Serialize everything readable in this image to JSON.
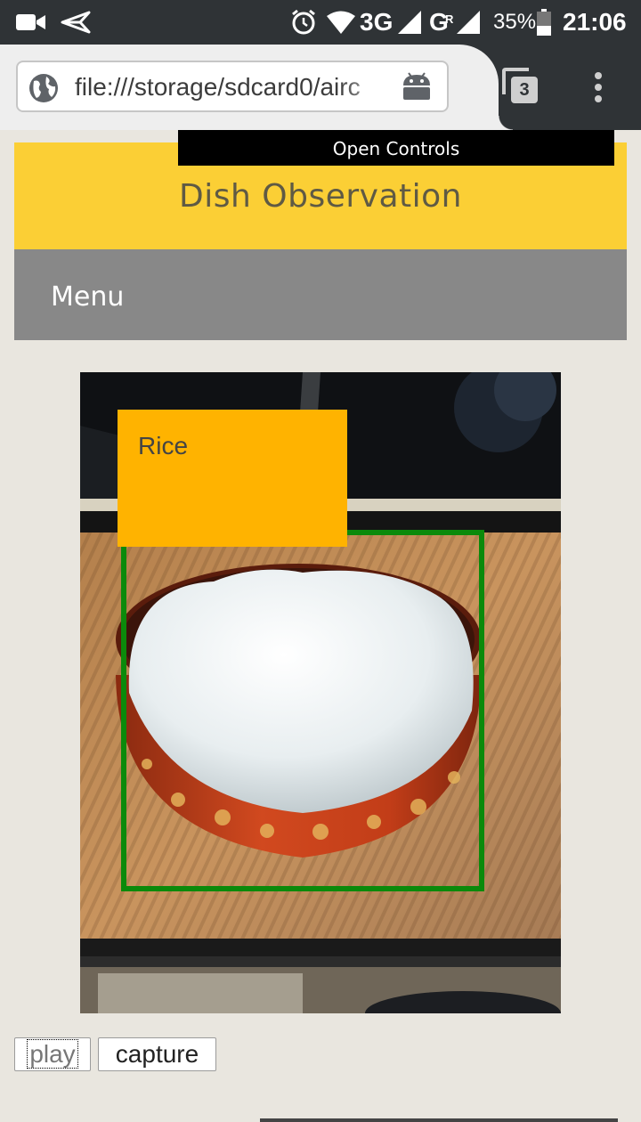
{
  "status_bar": {
    "icons": [
      "video-camera-icon",
      "send-icon",
      "alarm-icon",
      "wifi-icon",
      "signal-icon",
      "signal-roaming-icon",
      "battery-icon"
    ],
    "network_3g": "3G",
    "network_g": "G",
    "roaming_mark": "R",
    "battery_percent": "35%",
    "time": "21:06"
  },
  "browser": {
    "url": "file:///storage/sdcard0/airc",
    "tab_count": "3",
    "icons": [
      "globe-icon",
      "android-icon",
      "tabs-icon",
      "more-vert-icon"
    ]
  },
  "page": {
    "open_controls_label": "Open Controls",
    "title": "Dish Observation",
    "menu_label": "Menu"
  },
  "detection": {
    "label": "Rice",
    "box_color": "#0b8a0b",
    "label_color": "#ffb300"
  },
  "buttons": {
    "play": "play",
    "capture": "capture"
  },
  "colors": {
    "header": "#fbcf35",
    "menu_bar": "#888888",
    "background": "#e9e6df"
  }
}
